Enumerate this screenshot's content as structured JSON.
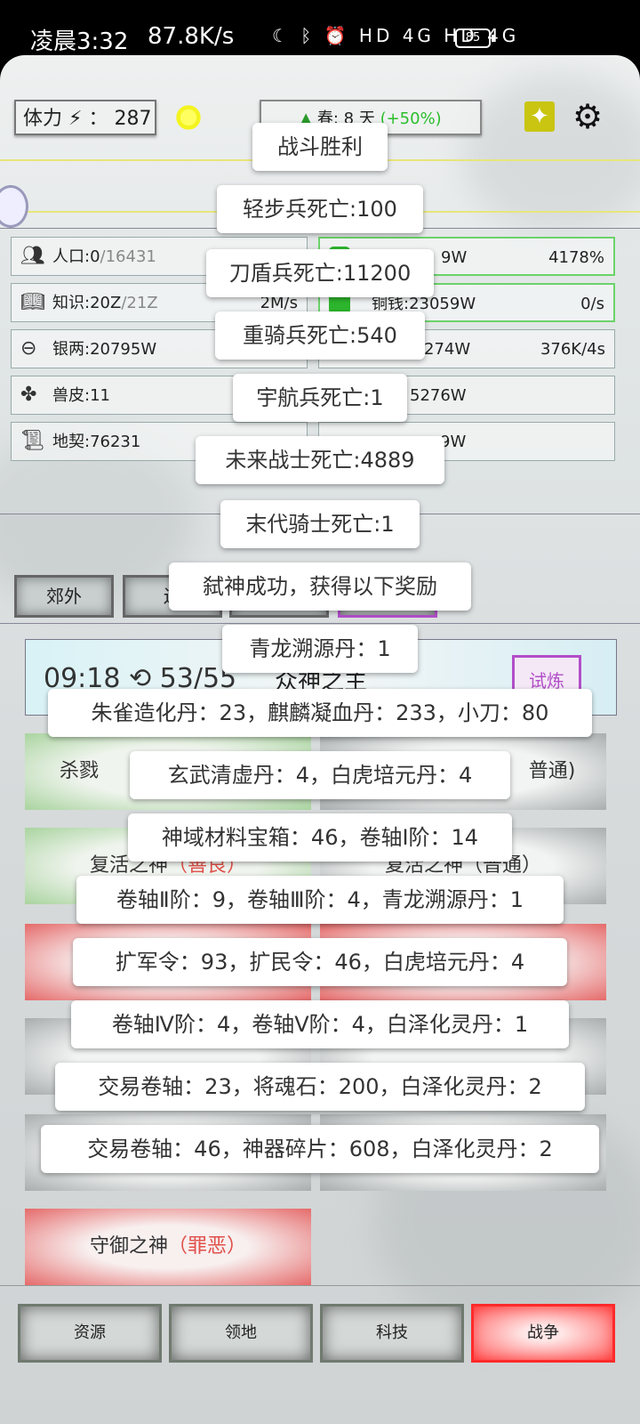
{
  "status_bar": {
    "time": "凌晨3:32",
    "speed": "87.8K/s",
    "icons_text": "☾ ᛒ ⏰ HD 4G HD 4G",
    "battery": "85"
  },
  "header": {
    "stamina_label": "体力",
    "stamina_sep": "：",
    "stamina_value": "287",
    "season_text": "春: 8 天",
    "season_bonus": "(+50%)"
  },
  "resources": [
    {
      "icon": "people-icon",
      "label": "人口:0",
      "max": "/16431",
      "right": ""
    },
    {
      "icon": "green-resource-icon",
      "label": "9W",
      "max": "",
      "right": "4178%"
    },
    {
      "icon": "book-icon",
      "label": "知识:20Z",
      "max": "/21Z",
      "right": "2M/s"
    },
    {
      "icon": "coin-icon",
      "label": "铜钱:23059W",
      "max": "",
      "right": "0/s"
    },
    {
      "icon": "silver-icon",
      "label": "银两:20795W",
      "max": "",
      "right": ""
    },
    {
      "icon": "resource-icon",
      "label": "274W",
      "max": "",
      "right": "376K/4s"
    },
    {
      "icon": "hide-icon",
      "label": "兽皮:11",
      "max": "",
      "right": ""
    },
    {
      "icon": "resource-icon",
      "label": "5276W",
      "max": "",
      "right": ""
    },
    {
      "icon": "deed-icon",
      "label": "地契:76231",
      "max": "",
      "right": ""
    },
    {
      "icon": "resource-icon",
      "label": "9W",
      "max": "",
      "right": ""
    }
  ],
  "tabs": [
    "郊外",
    "边"
  ],
  "timer": {
    "text": "09:18 ⟲ 53/55",
    "center": "众神之主",
    "trial_button": "试炼"
  },
  "cards": [
    {
      "label": "杀戮",
      "tag": "",
      "style": "green"
    },
    {
      "label": "普通)",
      "tag": "",
      "style": "gray"
    },
    {
      "label": "复活之神",
      "tag": "（善良）",
      "style": "green"
    },
    {
      "label": "复活之神（普通）",
      "tag": "",
      "style": "gray"
    },
    {
      "label": "",
      "tag": "",
      "style": "red"
    },
    {
      "label": "",
      "tag": "",
      "style": "red"
    },
    {
      "label": "",
      "tag": "",
      "style": "gray"
    },
    {
      "label": "",
      "tag": "",
      "style": "gray"
    },
    {
      "label": "",
      "tag": "",
      "style": "gray"
    },
    {
      "label": "",
      "tag": "",
      "style": "gray"
    },
    {
      "label": "守御之神",
      "tag": "（罪恶）",
      "style": "red"
    }
  ],
  "bottom_nav": [
    "资源",
    "领地",
    "科技",
    "战争"
  ],
  "toasts": [
    "战斗胜利",
    "轻步兵死亡:100",
    "刀盾兵死亡:11200",
    "重骑兵死亡:540",
    "宇航兵死亡:1",
    "未来战士死亡:4889",
    "末代骑士死亡:1",
    "弑神成功，获得以下奖励",
    "青龙溯源丹：1",
    "朱雀造化丹：23，麒麟凝血丹：233，小刀：80",
    "玄武清虚丹：4，白虎培元丹：4",
    "神域材料宝箱：46，卷轴Ⅰ阶：14",
    "卷轴Ⅱ阶：9，卷轴Ⅲ阶：4，青龙溯源丹：1",
    "扩军令：93，扩民令：46，白虎培元丹：4",
    "卷轴Ⅳ阶：4，卷轴Ⅴ阶：4，白泽化灵丹：1",
    "交易卷轴：23，将魂石：200，白泽化灵丹：2",
    "交易卷轴：46，神器碎片：608，白泽化灵丹：2"
  ]
}
